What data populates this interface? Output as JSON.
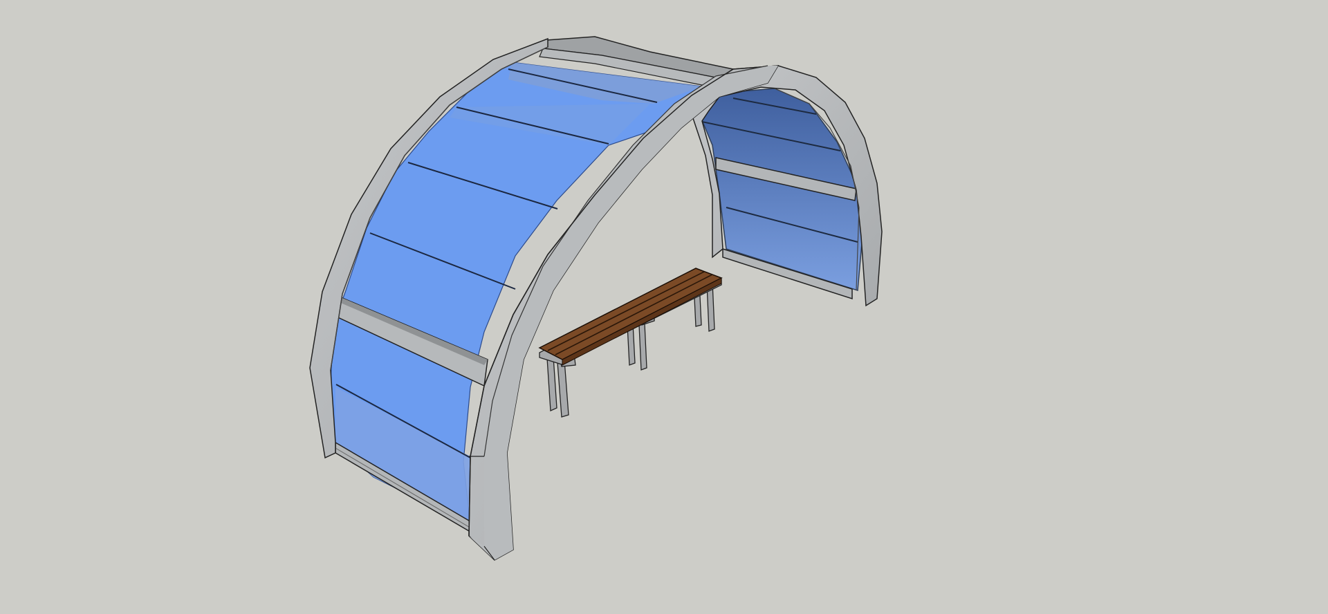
{
  "app": {
    "viewport": "3d-model-viewport"
  },
  "scene": {
    "background_color": "#cdcdc8",
    "objects": [
      {
        "name": "arched-shelter",
        "frame_color": "#a9acae",
        "panel_color": "#6a9aee"
      },
      {
        "name": "wooden-bench",
        "seat_color": "#7b4a26",
        "leg_color": "#a7a9ab"
      }
    ]
  }
}
